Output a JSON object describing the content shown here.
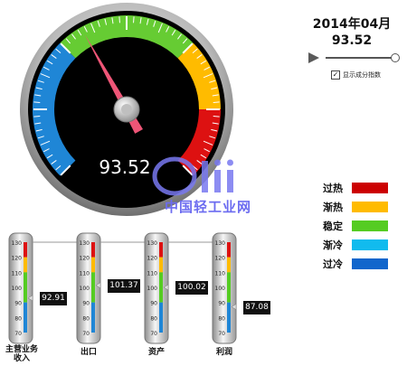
{
  "gauge": {
    "value": 93.52,
    "value_text": "93.52",
    "min": 70,
    "max": 130,
    "bands": [
      {
        "name": "过冷",
        "from": 70,
        "to": 90,
        "color": "#1f86d6"
      },
      {
        "name": "稳定",
        "from": 90,
        "to": 110,
        "color": "#66cc33"
      },
      {
        "name": "渐热",
        "from": 110,
        "to": 120,
        "color": "#ffbb00"
      },
      {
        "name": "过热",
        "from": 120,
        "to": 130,
        "color": "#dd1111"
      }
    ]
  },
  "header": {
    "date": "2014年04月",
    "value": "93.52"
  },
  "controls": {
    "play_icon": "play-icon",
    "slider_fraction": 0.95,
    "checkbox_label": "显示成分指数",
    "checkbox_checked": true
  },
  "legend": [
    {
      "label": "过热",
      "color": "#cc0000"
    },
    {
      "label": "渐热",
      "color": "#ffbb00"
    },
    {
      "label": "稳定",
      "color": "#55cc22"
    },
    {
      "label": "渐冷",
      "color": "#11bbee"
    },
    {
      "label": "过冷",
      "color": "#1166cc"
    }
  ],
  "watermark": {
    "text": "中国轻工业网",
    "logo": "cLii"
  },
  "thermometers": [
    {
      "label": "主营业务收入",
      "value": 92.91,
      "value_text": "92.91"
    },
    {
      "label": "出口",
      "value": 101.37,
      "value_text": "101.37"
    },
    {
      "label": "资产",
      "value": 100.02,
      "value_text": "100.02"
    },
    {
      "label": "利润",
      "value": 87.08,
      "value_text": "87.08"
    }
  ],
  "therm_ticks": [
    "130",
    "120",
    "110",
    "100",
    "90",
    "80",
    "70"
  ]
}
